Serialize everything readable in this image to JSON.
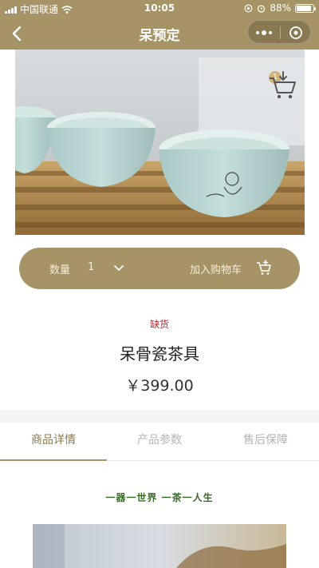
{
  "status_bar": {
    "carrier": "中国联通",
    "time": "10:05",
    "battery": "88%",
    "battery_level": 0.88
  },
  "nav": {
    "title": "呆预定"
  },
  "cart_float": {
    "count": "1"
  },
  "purchase_bar": {
    "quantity_label": "数量",
    "quantity_value": "1",
    "add_to_cart": "加入购物车"
  },
  "product": {
    "stock_status": "缺货",
    "name": "呆骨瓷茶具",
    "price": "￥399.00"
  },
  "tabs": [
    {
      "label": "商品详情",
      "active": true
    },
    {
      "label": "产品参数",
      "active": false
    },
    {
      "label": "售后保障",
      "active": false
    }
  ],
  "detail": {
    "slogan": "一器一世界  一茶一人生"
  },
  "colors": {
    "brand_gold": "#a69466",
    "out_of_stock": "#b3272a",
    "slogan_green": "#3a6a2a"
  }
}
